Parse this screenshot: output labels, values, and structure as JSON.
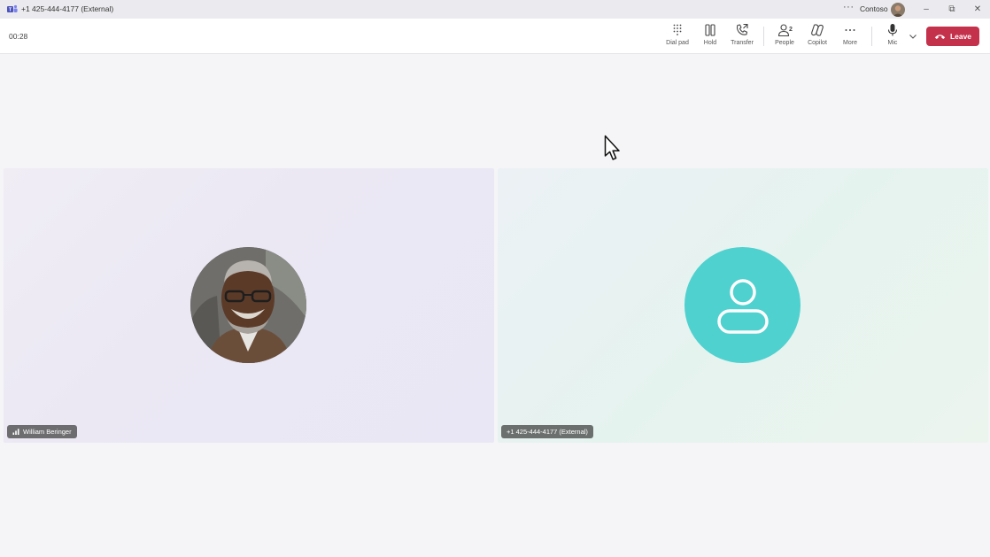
{
  "window": {
    "title": "+1 425-444-4177 (External)",
    "more_label": "···",
    "account_name": "Contoso",
    "minimize_glyph": "–",
    "restore_glyph": "⧉",
    "close_glyph": "✕"
  },
  "toolbar": {
    "timer": "00:28",
    "tools": {
      "dialpad": "Dial pad",
      "hold": "Hold",
      "transfer": "Transfer",
      "people": "People",
      "people_count": "2",
      "copilot": "Copilot",
      "more": "More",
      "mic": "Mic"
    },
    "leave_label": "Leave"
  },
  "participants": [
    {
      "name": "William Beringer",
      "icon": "signal-bars-icon"
    },
    {
      "name": "+1 425-444-4177 (External)"
    }
  ],
  "colors": {
    "leave": "#c4314b",
    "generic_avatar": "#4ed1cf",
    "teams_brand": "#5b5fc7"
  }
}
